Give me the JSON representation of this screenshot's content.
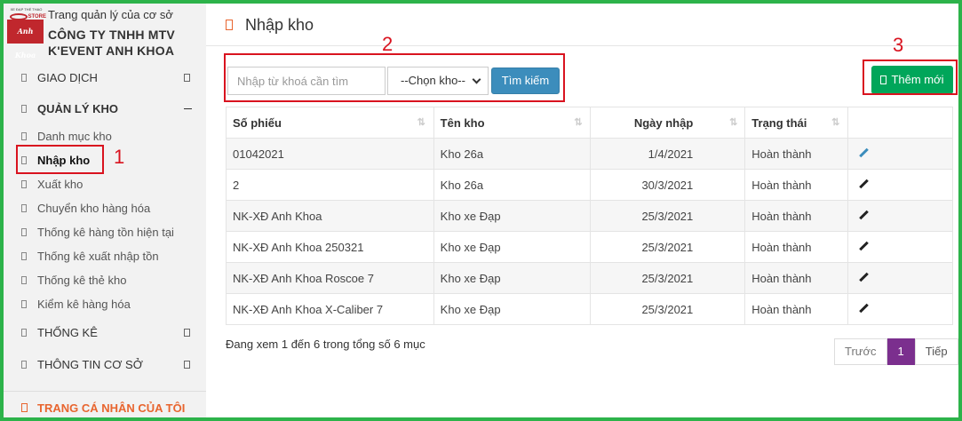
{
  "sidebar": {
    "logo_top": "XE ĐẠP THỂ THAO",
    "logo_brand": "Anh Khoa",
    "logo_brand2": "STORE",
    "org_sub": "Trang quản lý của cơ sở",
    "org_name": "CÔNG TY TNHH MTV K'EVENT ANH KHOA",
    "items": [
      {
        "label": "GIAO DỊCH"
      },
      {
        "label": "QUẢN LÝ KHO"
      },
      {
        "label": "Danh mục kho"
      },
      {
        "label": "Nhập kho"
      },
      {
        "label": "Xuất kho"
      },
      {
        "label": "Chuyển kho hàng hóa"
      },
      {
        "label": "Thống kê hàng tồn hiện tại"
      },
      {
        "label": "Thống kê xuất nhập tồn"
      },
      {
        "label": "Thống kê thẻ kho"
      },
      {
        "label": "Kiểm kê hàng hóa"
      },
      {
        "label": "THỐNG KÊ"
      },
      {
        "label": "THÔNG TIN CƠ SỞ"
      }
    ],
    "personal": "TRANG CÁ NHÂN CỦA TÔI"
  },
  "annotations": [
    "1",
    "2",
    "3"
  ],
  "page": {
    "title": "Nhập kho"
  },
  "toolbar": {
    "search_placeholder": "Nhập từ khoá cần tìm",
    "warehouse_select": "--Chọn kho--",
    "search_label": "Tìm kiếm",
    "add_label": "Thêm mới"
  },
  "table": {
    "columns": [
      "Số phiếu",
      "Tên kho",
      "Ngày nhập",
      "Trạng thái"
    ],
    "rows": [
      {
        "code": "01042021",
        "warehouse": "Kho 26a",
        "date": "1/4/2021",
        "status": "Hoàn thành"
      },
      {
        "code": "2",
        "warehouse": "Kho 26a",
        "date": "30/3/2021",
        "status": "Hoàn thành"
      },
      {
        "code": "NK-XĐ Anh Khoa",
        "warehouse": "Kho xe Đạp",
        "date": "25/3/2021",
        "status": "Hoàn thành"
      },
      {
        "code": "NK-XĐ Anh Khoa 250321",
        "warehouse": "Kho xe Đạp",
        "date": "25/3/2021",
        "status": "Hoàn thành"
      },
      {
        "code": "NK-XĐ Anh Khoa Roscoe 7",
        "warehouse": "Kho xe Đạp",
        "date": "25/3/2021",
        "status": "Hoàn thành"
      },
      {
        "code": "NK-XĐ Anh Khoa X-Caliber 7",
        "warehouse": "Kho xe Đạp",
        "date": "25/3/2021",
        "status": "Hoàn thành"
      }
    ]
  },
  "footer": {
    "info": "Đang xem 1 đến 6 trong tổng số 6 mục",
    "prev": "Trước",
    "current": "1",
    "next": "Tiếp"
  },
  "colors": {
    "frame": "#2db34a",
    "annotation": "#d9131f",
    "primary": "#3c8dbc",
    "success": "#00a65a",
    "page_active": "#7b2f8e",
    "accent": "#e8652f"
  }
}
